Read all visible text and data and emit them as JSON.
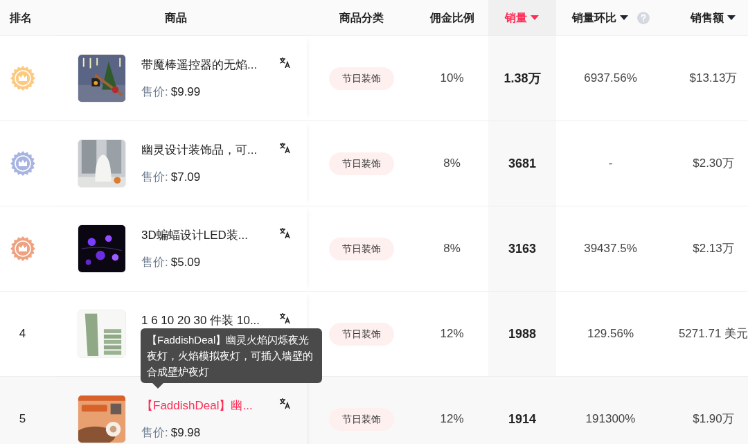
{
  "columns": [
    {
      "label": "排名",
      "sortable": false,
      "active": false
    },
    {
      "label": "商品",
      "sortable": false,
      "active": false
    },
    {
      "label": "商品分类",
      "sortable": false,
      "active": false
    },
    {
      "label": "佣金比例",
      "sortable": false,
      "active": false
    },
    {
      "label": "销量",
      "sortable": true,
      "active": true
    },
    {
      "label": "销量环比",
      "sortable": true,
      "active": false,
      "help": true
    },
    {
      "label": "销售额",
      "sortable": true,
      "active": false
    }
  ],
  "rows": [
    {
      "rank": {
        "kind": "medal",
        "color": "#fcc97f"
      },
      "title": "带魔棒遥控器的无焰...",
      "price_label": "售价:",
      "price": "$9.99",
      "category": "节日装饰",
      "commission": "10%",
      "sales": "1.38万",
      "mom": "6937.56%",
      "revenue": "$13.13万",
      "hovered": false
    },
    {
      "rank": {
        "kind": "medal",
        "color": "#a7b4e2"
      },
      "title": "幽灵设计装饰品，可...",
      "price_label": "售价:",
      "price": "$7.09",
      "category": "节日装饰",
      "commission": "8%",
      "sales": "3681",
      "mom": "-",
      "revenue": "$2.30万",
      "hovered": false
    },
    {
      "rank": {
        "kind": "medal",
        "color": "#eea27f"
      },
      "title": "3D蝙蝠设计LED装...",
      "price_label": "售价:",
      "price": "$5.09",
      "category": "节日装饰",
      "commission": "8%",
      "sales": "3163",
      "mom": "39437.5%",
      "revenue": "$2.13万",
      "hovered": false
    },
    {
      "rank": {
        "kind": "number",
        "text": "4"
      },
      "title": "1 6 10 20 30 件装 10...",
      "category": "节日装饰",
      "commission": "12%",
      "sales": "1988",
      "mom": "129.56%",
      "revenue": "5271.71 美元",
      "hovered": false
    },
    {
      "rank": {
        "kind": "number",
        "text": "5"
      },
      "title": "【FaddishDeal】幽...",
      "price_label": "售价:",
      "price": "$9.98",
      "category": "节日装饰",
      "commission": "12%",
      "sales": "1914",
      "mom": "191300%",
      "revenue": "$1.90万",
      "hovered": true
    }
  ],
  "tooltip": "【FaddishDeal】幽灵火焰闪烁夜光夜灯，火焰模拟夜灯，可插入墙壁的合成壁炉夜灯"
}
